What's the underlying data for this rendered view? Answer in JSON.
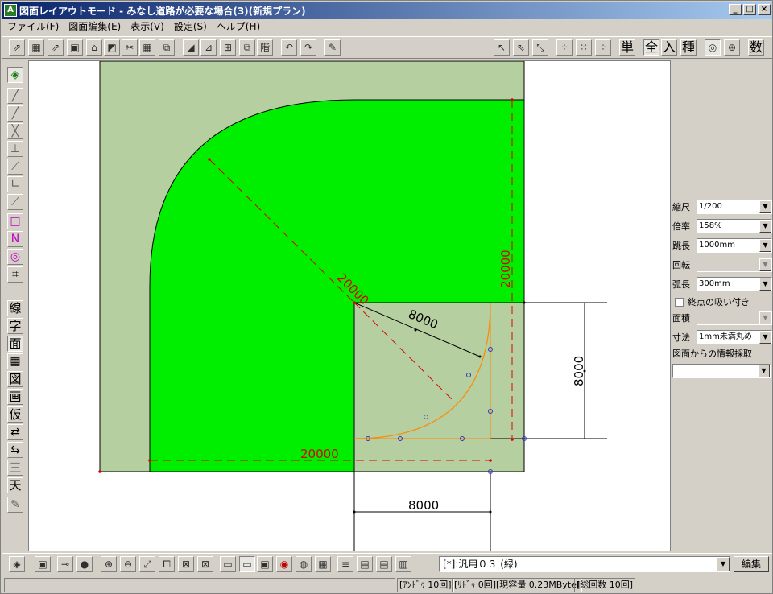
{
  "window": {
    "title": "図面レイアウトモード - みなし道路が必要な場合(3)(新規プラン)",
    "app_icon": "A",
    "minimize": "_",
    "maximize": "□",
    "close": "×"
  },
  "menu": [
    {
      "label": "ファイル(F)"
    },
    {
      "label": "図面編集(E)"
    },
    {
      "label": "表示(V)"
    },
    {
      "label": "設定(S)"
    },
    {
      "label": "ヘルプ(H)"
    }
  ],
  "toolbar_text": {
    "single": "単",
    "all": "全",
    "input": "入",
    "kind": "種",
    "number": "数"
  },
  "left_tools_text": {
    "line": "線",
    "char": "字",
    "face": "面",
    "figure": "図",
    "picture": "画",
    "temp": "仮",
    "three": "三",
    "sky": "天"
  },
  "properties": {
    "scale_label": "縮尺",
    "scale_value": "1/200",
    "magnification_label": "倍率",
    "magnification_value": "158%",
    "jump_label": "跳長",
    "jump_value": "1000mm",
    "rotation_label": "回転",
    "rotation_value": "",
    "arc_label": "弧長",
    "arc_value": "300mm",
    "endpoint_snap_label": "終点の吸い付き",
    "area_label": "面積",
    "area_value": "",
    "dimension_label": "寸法",
    "dimension_value": "1mm未満丸め",
    "extract_label": "図面からの情報採取",
    "extract_value": ""
  },
  "drawing": {
    "dim_diagonal": "20000",
    "dim_vertical_red": "20000",
    "dim_bottom_red": "20000",
    "dim_radius": "8000",
    "dim_right_vertical": "8000",
    "dim_bottom_black": "8000",
    "colors": {
      "road_fill": "#b6cfa0",
      "area_fill": "#00ee00",
      "red_dim": "#dd0000",
      "orange_arc": "#ff8800",
      "blue_point": "#3030c0"
    }
  },
  "bottom": {
    "layer_selector": "[*]:汎用０３ (緑)",
    "edit_button": "編集"
  },
  "status": {
    "undo": "[ｱﾝﾄﾞｩ 10回]",
    "redo": "[ﾘﾄﾞｩ 0回]",
    "capacity": "[現容量 0.23MByte]",
    "total": "[総回数 10回]"
  }
}
